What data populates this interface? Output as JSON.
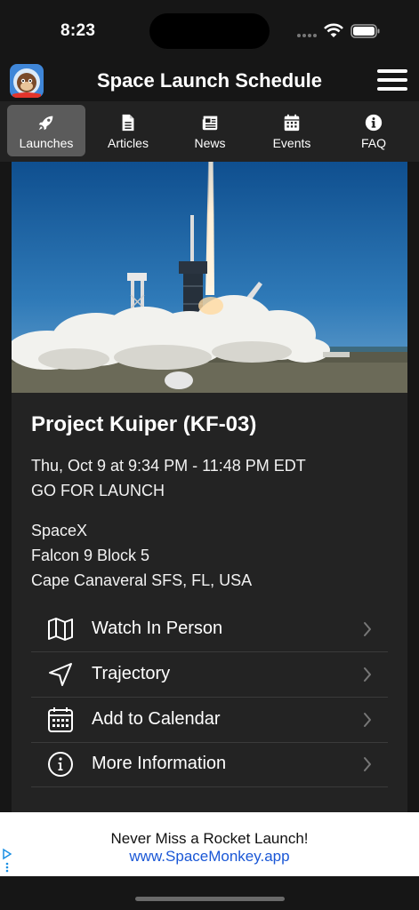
{
  "status_bar": {
    "time": "8:23"
  },
  "header": {
    "title": "Space Launch Schedule"
  },
  "tabs": [
    {
      "label": "Launches",
      "icon": "rocket-icon",
      "active": true
    },
    {
      "label": "Articles",
      "icon": "document-icon",
      "active": false
    },
    {
      "label": "News",
      "icon": "newspaper-icon",
      "active": false
    },
    {
      "label": "Events",
      "icon": "calendar-icon",
      "active": false
    },
    {
      "label": "FAQ",
      "icon": "info-icon",
      "active": false
    }
  ],
  "launch": {
    "title": "Project Kuiper (KF-03)",
    "datetime": "Thu, Oct 9 at 9:34 PM - 11:48 PM EDT",
    "status": "GO FOR LAUNCH",
    "provider": "SpaceX",
    "rocket": "Falcon 9 Block 5",
    "location": "Cape Canaveral SFS, FL, USA"
  },
  "actions": [
    {
      "label": "Watch In Person",
      "icon": "map-icon"
    },
    {
      "label": "Trajectory",
      "icon": "navigation-arrow-icon"
    },
    {
      "label": "Add to Calendar",
      "icon": "calendar-icon"
    },
    {
      "label": "More Information",
      "icon": "info-circle-icon"
    }
  ],
  "ad": {
    "headline": "Never Miss a Rocket Launch!",
    "link": "www.SpaceMonkey.app"
  },
  "colors": {
    "background": "#161616",
    "card": "#232323",
    "tab_bar": "#222222",
    "active_tab": "#5b5b5b",
    "ad_link": "#1a57d6"
  }
}
